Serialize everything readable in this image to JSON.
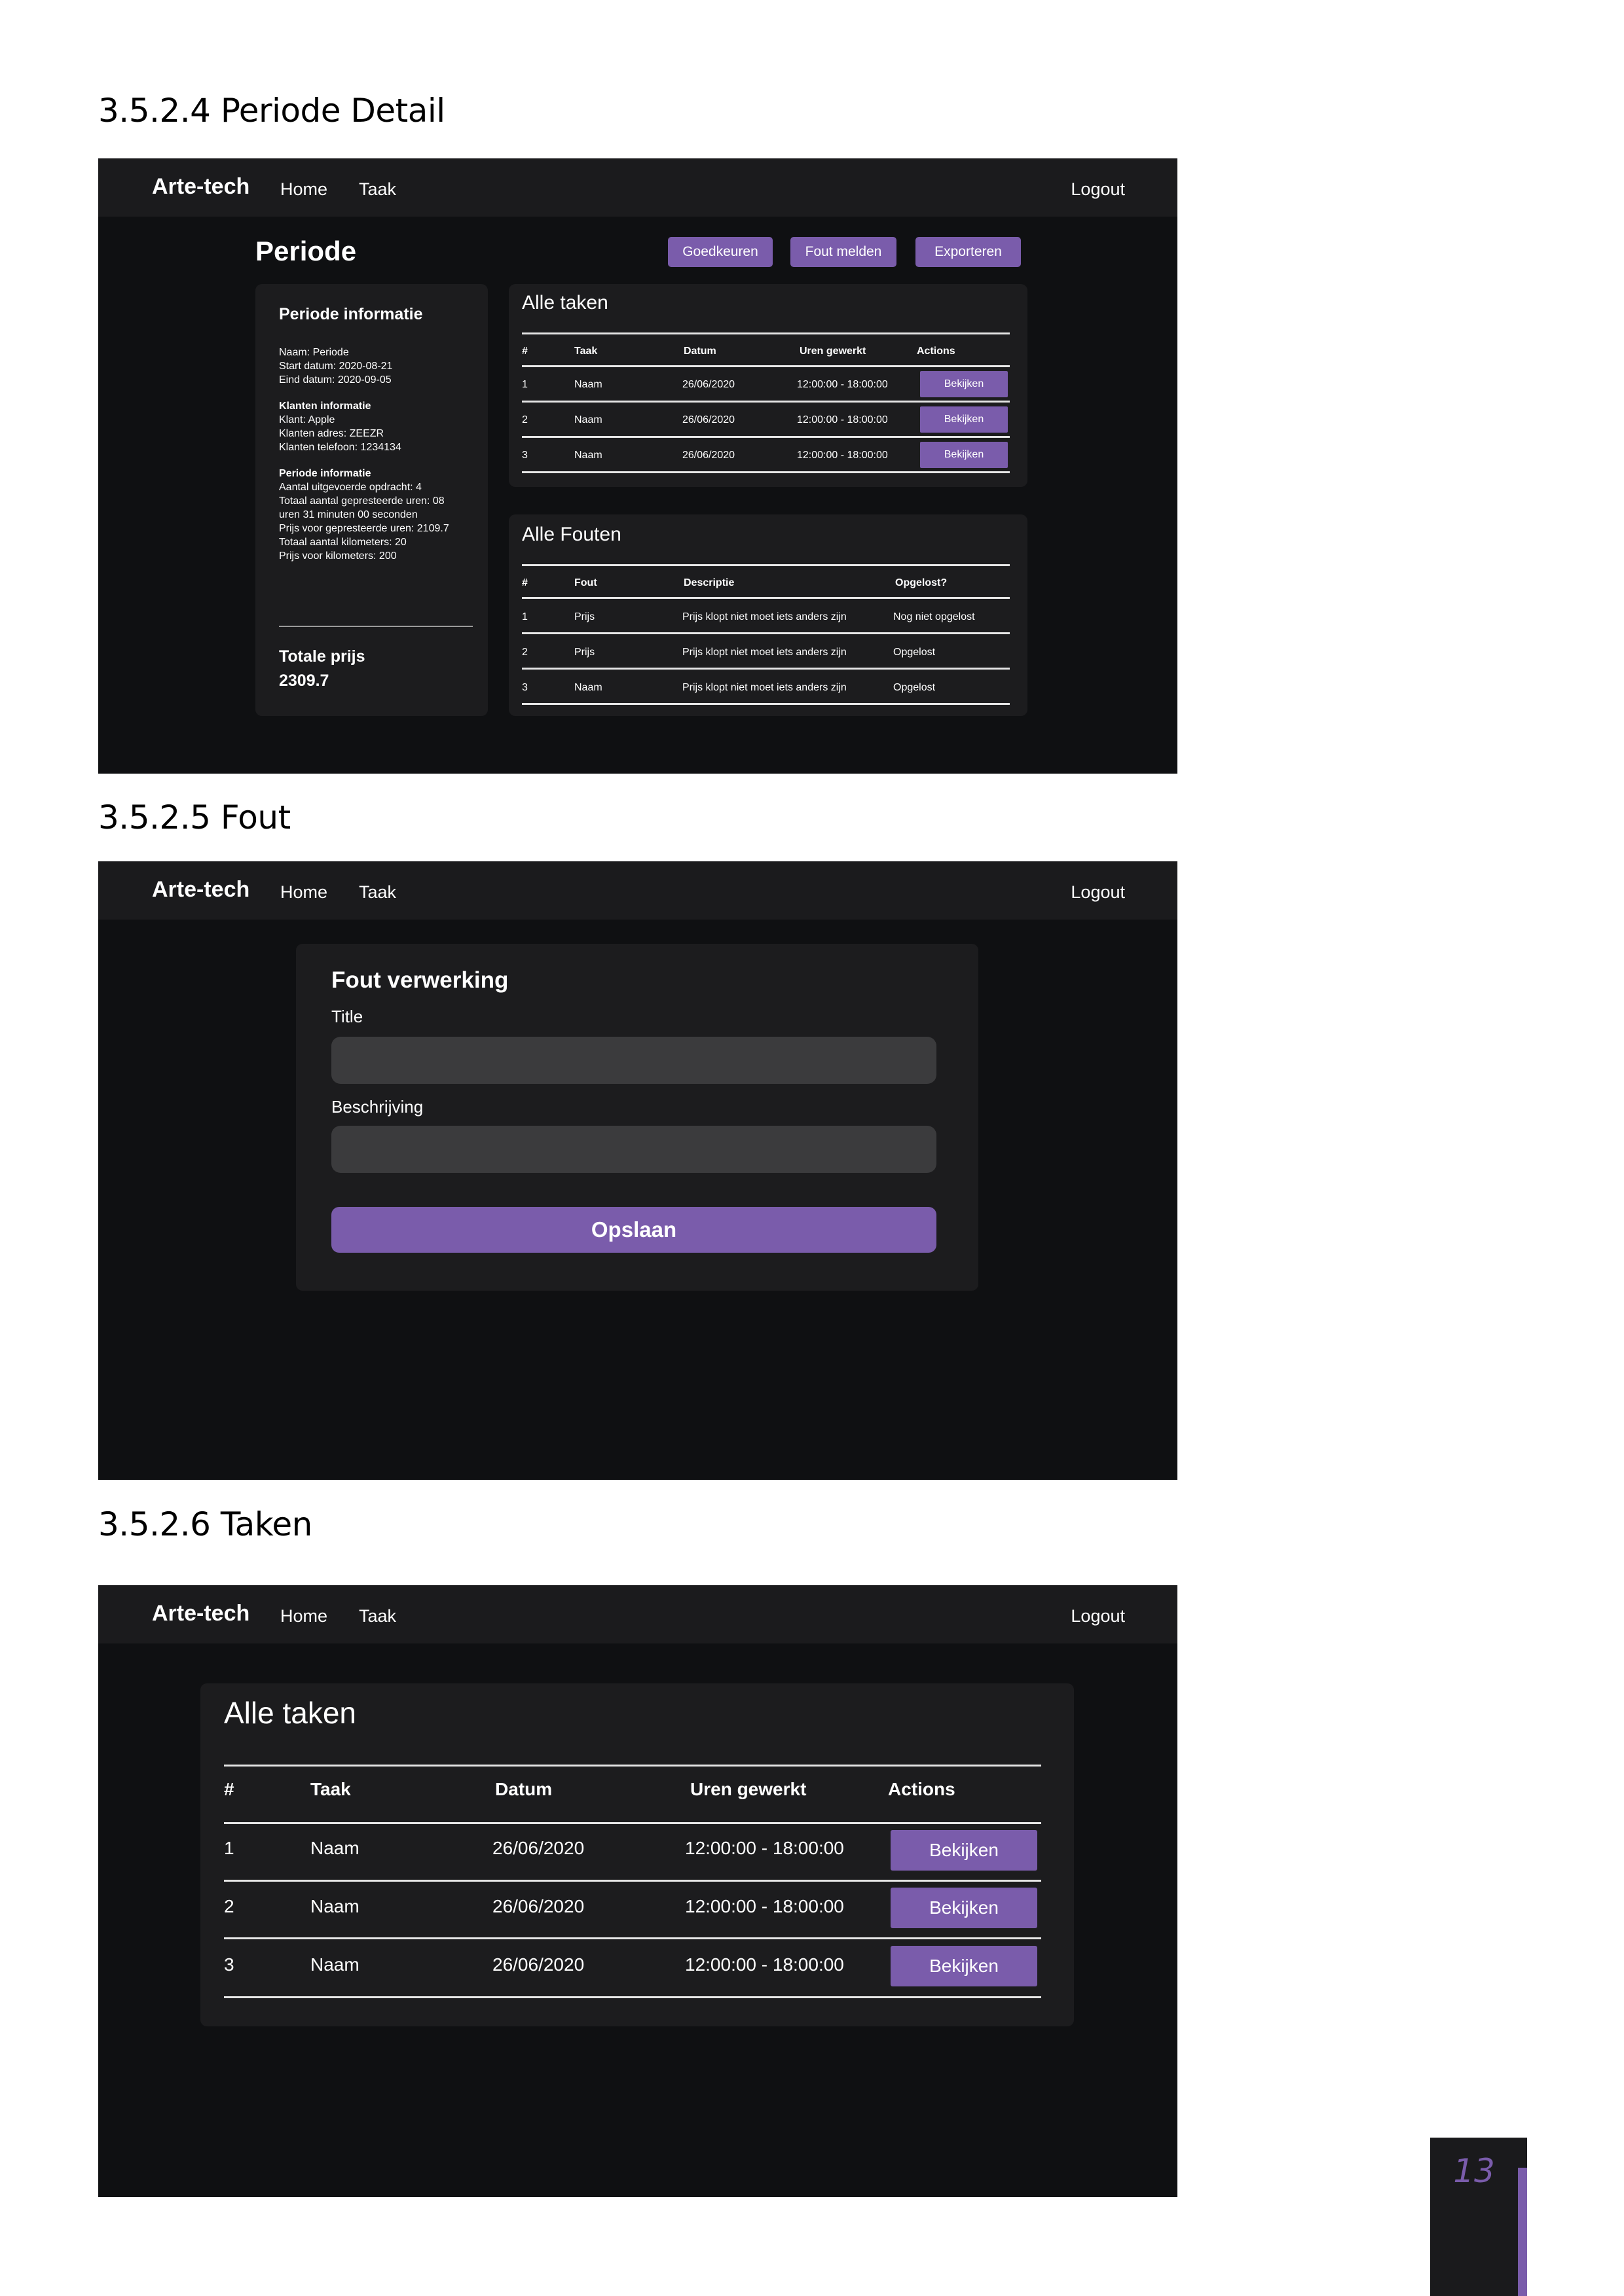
{
  "sections": {
    "periode": "3.5.2.4 Periode Detail",
    "fout": "3.5.2.5 Fout",
    "taken": "3.5.2.6 Taken"
  },
  "nav": {
    "brand": "Arte-tech",
    "home": "Home",
    "taak": "Taak",
    "logout": "Logout"
  },
  "periode_detail": {
    "title": "Periode",
    "buttons": {
      "approve": "Goedkeuren",
      "report": "Fout melden",
      "export": "Exporteren"
    },
    "info": {
      "heading": "Periode informatie",
      "naam": "Naam: Periode",
      "start": "Start datum: 2020-08-21",
      "eind": "Eind datum: 2020-09-05",
      "klanten_heading": "Klanten informatie",
      "klant": "Klant: Apple",
      "adres": "Klanten adres: ZEEZR",
      "telefoon": "Klanten telefoon: 1234134",
      "periode_heading": "Periode informatie",
      "opdrachten": "Aantal uitgevoerde opdracht: 4",
      "uren_1": "Totaal aantal gepresteerde uren: 08",
      "uren_2": "uren 31 minuten 00 seconden",
      "prijs_uren": "Prijs voor gepresteerde uren: 2109.7",
      "km": "Totaal aantal kilometers: 20",
      "prijs_km": "Prijs voor kilometers: 200",
      "totaal_label": "Totale prijs",
      "totaal_value": "2309.7"
    },
    "taken": {
      "title": "Alle taken",
      "headers": [
        "#",
        "Taak",
        "Datum",
        "Uren gewerkt",
        "Actions"
      ],
      "rows": [
        [
          "1",
          "Naam",
          "26/06/2020",
          "12:00:00 - 18:00:00",
          "Bekijken"
        ],
        [
          "2",
          "Naam",
          "26/06/2020",
          "12:00:00 - 18:00:00",
          "Bekijken"
        ],
        [
          "3",
          "Naam",
          "26/06/2020",
          "12:00:00 - 18:00:00",
          "Bekijken"
        ]
      ]
    },
    "fouten": {
      "title": "Alle Fouten",
      "headers": [
        "#",
        "Fout",
        "Descriptie",
        "Opgelost?"
      ],
      "rows": [
        [
          "1",
          "Prijs",
          "Prijs klopt niet moet iets anders zijn",
          "Nog niet opgelost"
        ],
        [
          "2",
          "Prijs",
          "Prijs klopt niet moet iets anders zijn",
          "Opgelost"
        ],
        [
          "3",
          "Naam",
          "Prijs klopt niet moet iets anders zijn",
          "Opgelost"
        ]
      ]
    }
  },
  "fout_form": {
    "title": "Fout verwerking",
    "title_label": "Title",
    "title_value": "",
    "desc_label": "Beschrijving",
    "desc_value": "",
    "save": "Opslaan"
  },
  "taken_page": {
    "title": "Alle taken",
    "headers": [
      "#",
      "Taak",
      "Datum",
      "Uren gewerkt",
      "Actions"
    ],
    "rows": [
      [
        "1",
        "Naam",
        "26/06/2020",
        "12:00:00 - 18:00:00",
        "Bekijken"
      ],
      [
        "2",
        "Naam",
        "26/06/2020",
        "12:00:00 - 18:00:00",
        "Bekijken"
      ],
      [
        "3",
        "Naam",
        "26/06/2020",
        "12:00:00 - 18:00:00",
        "Bekijken"
      ]
    ]
  },
  "page_number": "13",
  "colors": {
    "accent": "#7a5cab",
    "background": "#0f1012",
    "card": "#1c1c1e",
    "nav": "#1b1b1d"
  }
}
